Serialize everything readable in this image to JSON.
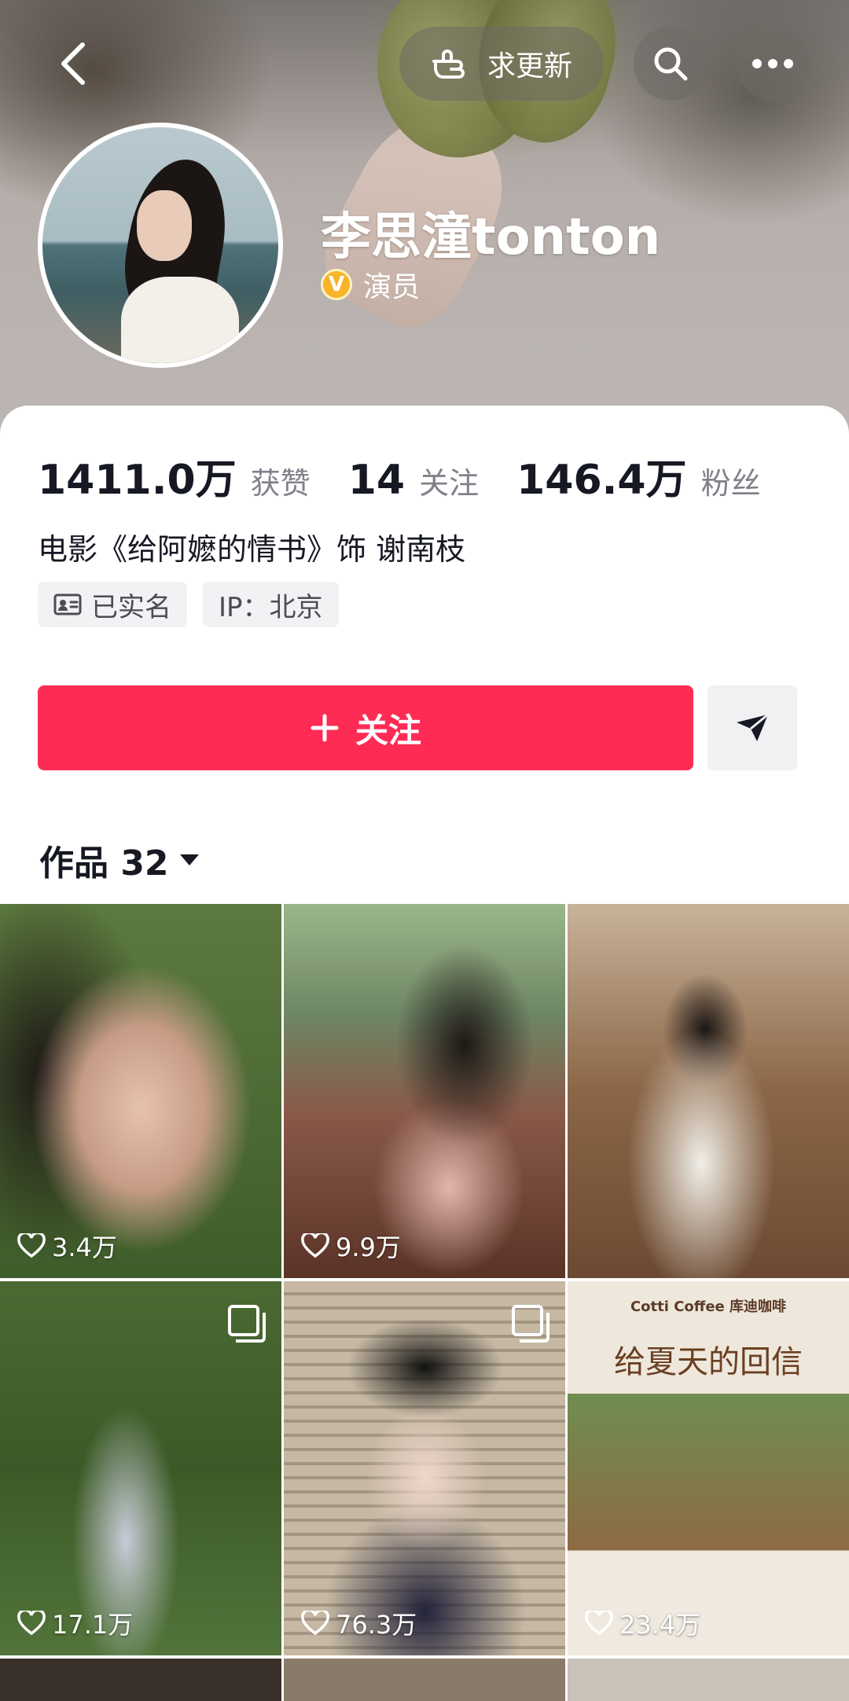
{
  "header": {
    "update_label": "求更新",
    "name": "李思潼tonton",
    "role": "演员",
    "verified_badge": "V"
  },
  "stats": {
    "likes_value": "1411.0万",
    "likes_label": "获赞",
    "following_value": "14",
    "following_label": "关注",
    "followers_value": "146.4万",
    "followers_label": "粉丝"
  },
  "bio": "电影《给阿嬷的情书》饰 谢南枝",
  "tags": {
    "verified_label": "已实名",
    "ip_label": "IP：北京"
  },
  "actions": {
    "follow_label": "关注"
  },
  "works": {
    "tab_label": "作品 32"
  },
  "grid": {
    "tiles": [
      {
        "likes": "3.4万"
      },
      {
        "likes": "9.9万"
      },
      {
        "likes": ""
      },
      {
        "likes": "17.1万"
      },
      {
        "likes": "76.3万"
      },
      {
        "likes": "23.4万"
      }
    ],
    "poster": {
      "brand": "Cotti Coffee 库迪咖啡",
      "title": "给夏天的回信"
    }
  },
  "colors": {
    "primary": "#fe2c55",
    "badge": "#f6b52a"
  }
}
